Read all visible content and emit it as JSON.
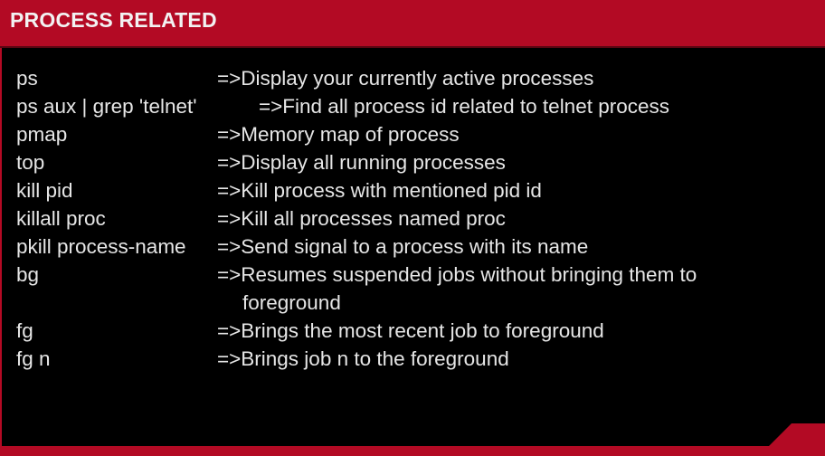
{
  "slide": {
    "title": "PROCESS RELATED",
    "colors": {
      "accent": "#b30a24",
      "background": "#000000",
      "text": "#e6e6e6"
    },
    "separator": "=>",
    "commands": [
      {
        "command": "ps",
        "description": "=>Display your currently active processes"
      },
      {
        "command": "ps aux | grep 'telnet'",
        "description": "=>Find all process id related to telnet process"
      },
      {
        "command": "pmap",
        "description": "=>Memory map of process"
      },
      {
        "command": "top",
        "description": "=>Display all running processes"
      },
      {
        "command": "kill pid",
        "description": "=>Kill process with mentioned pid id"
      },
      {
        "command": "killall proc",
        "description": "=>Kill all processes named proc"
      },
      {
        "command": "pkill process-name",
        "description": "=>Send signal to a process with its name"
      },
      {
        "command": "bg",
        "description": "=>Resumes suspended jobs without bringing them to",
        "description_continued": "foreground"
      },
      {
        "command": "fg",
        "description": "=>Brings the most recent job to foreground"
      },
      {
        "command": "fg n",
        "description": "=>Brings job n to the foreground"
      }
    ]
  }
}
